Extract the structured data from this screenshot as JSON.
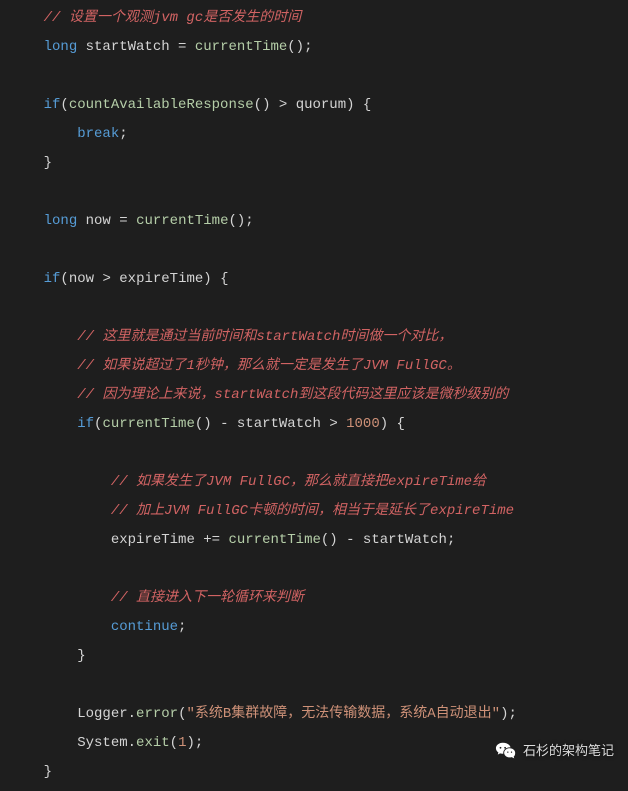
{
  "lines": {
    "l1": {
      "comment": "// 设置一个观测jvm gc是否发生的时间"
    },
    "l2": {
      "kw": "long",
      "var": "startWatch",
      "op": "=",
      "mtd": "currentTime",
      "paren": "()",
      "semi": ";"
    },
    "l3": {
      "blank": " "
    },
    "l4": {
      "kw": "if",
      "open": "(",
      "mtd": "countAvailableResponse",
      "paren": "()",
      "op": ">",
      "var": "quorum",
      "close": ") {"
    },
    "l5": {
      "kw": "break",
      "semi": ";"
    },
    "l6": {
      "brace": "}"
    },
    "l7": {
      "blank": " "
    },
    "l8": {
      "kw": "long",
      "var": "now",
      "op": "=",
      "mtd": "currentTime",
      "paren": "()",
      "semi": ";"
    },
    "l9": {
      "blank": " "
    },
    "l10": {
      "kw": "if",
      "open": "(",
      "var1": "now",
      "op": ">",
      "var2": "expireTime",
      "close": ") {"
    },
    "l11": {
      "blank": " "
    },
    "l12": {
      "comment": "// 这里就是通过当前时间和startWatch时间做一个对比，"
    },
    "l13": {
      "comment": "// 如果说超过了1秒钟，那么就一定是发生了JVM FullGC。"
    },
    "l14": {
      "comment": "// 因为理论上来说，startWatch到这段代码这里应该是微秒级别的"
    },
    "l15": {
      "kw": "if",
      "open": "(",
      "mtd": "currentTime",
      "paren": "()",
      "op1": "-",
      "var": "startWatch",
      "op2": ">",
      "num": "1000",
      "close": ") {"
    },
    "l16": {
      "blank": " "
    },
    "l17": {
      "comment": "// 如果发生了JVM FullGC，那么就直接把expireTime给"
    },
    "l18": {
      "comment": "// 加上JVM FullGC卡顿的时间，相当于是延长了expireTime"
    },
    "l19": {
      "var1": "expireTime",
      "op1": "+=",
      "mtd": "currentTime",
      "paren": "()",
      "op2": "-",
      "var2": "startWatch",
      "semi": ";"
    },
    "l20": {
      "blank": " "
    },
    "l21": {
      "comment": "// 直接进入下一轮循环来判断"
    },
    "l22": {
      "kw": "continue",
      "semi": ";"
    },
    "l23": {
      "brace": "}"
    },
    "l24": {
      "blank": " "
    },
    "l25": {
      "cls": "Logger",
      "dot": ".",
      "mtd": "error",
      "open": "(",
      "str": "\"系统B集群故障，无法传输数据，系统A自动退出\"",
      "close": ")",
      "semi": ";"
    },
    "l26": {
      "cls": "System",
      "dot": ".",
      "mtd": "exit",
      "open": "(",
      "num": "1",
      "close": ")",
      "semi": ";"
    },
    "l27": {
      "brace": "}"
    }
  },
  "watermark": {
    "text": "石杉的架构笔记"
  }
}
